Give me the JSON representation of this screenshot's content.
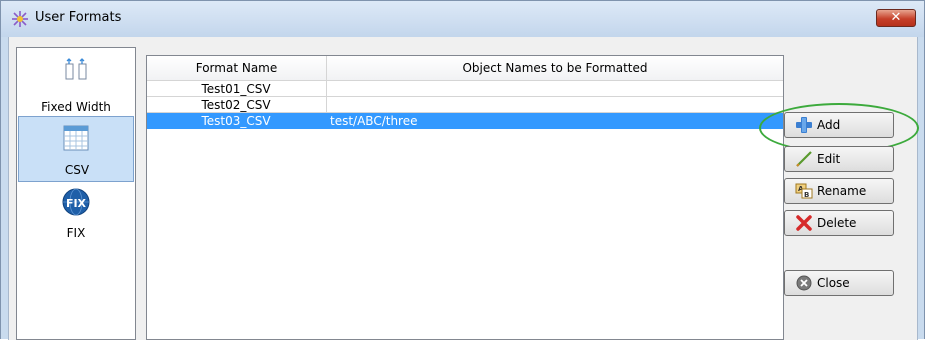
{
  "window": {
    "title": "User Formats",
    "close_glyph": "✕"
  },
  "formats": [
    {
      "label": "Fixed Width",
      "icon": "fixed-width-icon",
      "selected": false
    },
    {
      "label": "CSV",
      "icon": "csv-grid-icon",
      "selected": true
    },
    {
      "label": "FIX",
      "icon": "fix-globe-icon",
      "selected": false
    }
  ],
  "table": {
    "columns": [
      "Format Name",
      "Object Names to be Formatted"
    ],
    "rows": [
      {
        "name": "Test01_CSV",
        "objects": ""
      },
      {
        "name": "Test02_CSV",
        "objects": ""
      },
      {
        "name": "Test03_CSV",
        "objects": "test/ABC/three"
      }
    ],
    "selected_row": 2
  },
  "buttons": {
    "add": "Add",
    "edit": "Edit",
    "rename": "Rename",
    "delete": "Delete",
    "close": "Close"
  },
  "colors": {
    "selection": "#3399ff",
    "highlight_oval": "#3caa3c",
    "title_bar": "#c9dbee",
    "close_button": "#c6402a"
  }
}
